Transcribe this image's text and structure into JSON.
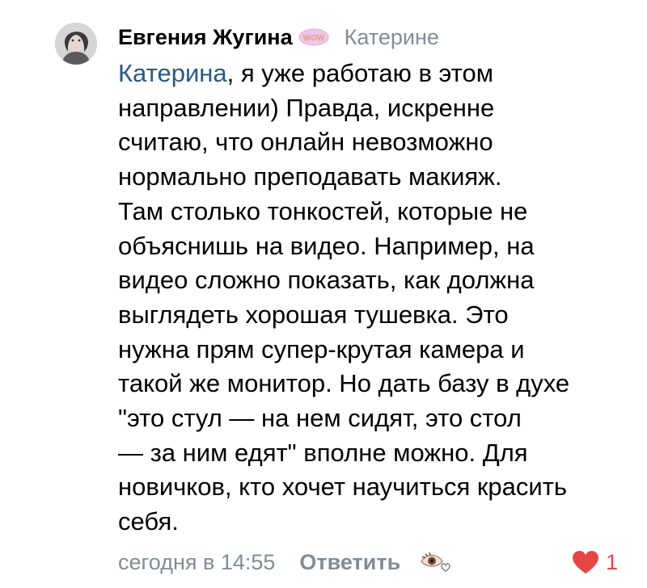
{
  "comment": {
    "author": "Евгения Жугина",
    "badge_icon": "wow-sticker-icon",
    "badge_text": "WOW",
    "reply_to": "Катерине",
    "mention": "Катерина",
    "body_lines": [
      ", я уже работаю в этом",
      "направлении) Правда, искренне",
      "считаю, что онлайн невозможно",
      "нормально преподавать макияж.",
      "Там столько тонкостей, которые не",
      "объяснишь на видео. Например, на",
      "видео сложно показать, как должна",
      "выглядеть хорошая тушевка. Это",
      "нужна прям супер-крутая камера и",
      "такой же монитор. Но дать базу в духе",
      "\"это стул — на нем сидят, это стол",
      "— за ним едят\" вполне можно. Для",
      "новичков, кто хочет научиться красить",
      "себя."
    ],
    "timestamp": "сегодня в 14:55",
    "reply_label": "Ответить",
    "reaction_icon": "eye-heart-reaction-icon",
    "like_icon": "heart-icon",
    "like_count": "1"
  },
  "colors": {
    "mention": "#2a5885",
    "secondary_text": "#818c99",
    "like": "#e64646"
  }
}
